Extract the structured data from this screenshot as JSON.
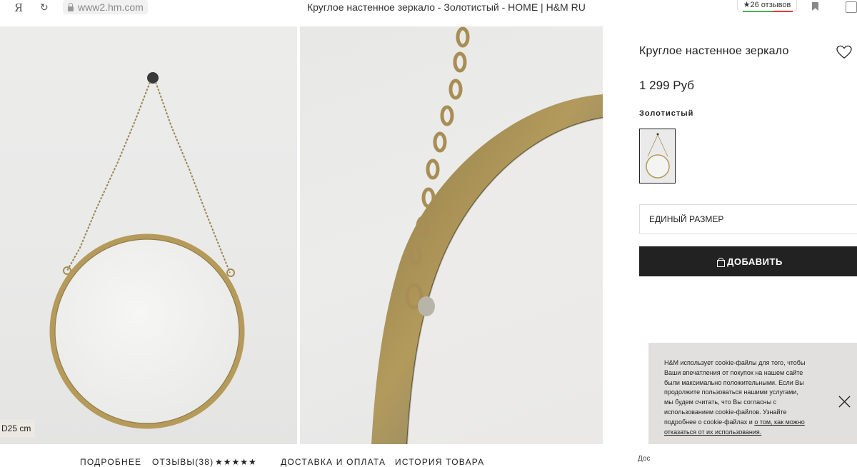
{
  "browser": {
    "ya_glyph": "Я",
    "reload_glyph": "↻",
    "url": "www2.hm.com",
    "tab_title": "Круглое настенное зеркало - Золотистый - HOME | H&M RU",
    "reviews_badge": "★26 отзывов"
  },
  "product": {
    "title": "Круглое настенное зеркало",
    "price": "1 299 Руб",
    "color_label": "Золотистый",
    "size_value": "ЕДИНЫЙ РАЗМЕР",
    "add_button": "ДОБАВИТЬ",
    "size_tag": "D25 cm"
  },
  "cookie": {
    "text": "H&M использует cookie-файлы для того, чтобы Ваши впечатления от покупок на нашем сайте были максимально положительными. Если Вы продолжите пользоваться нашими услугами, мы будем считать, что Вы согласны с использованием cookie-файлов. Узнайте подробнее о cookie-файлах и ",
    "link": "о том, как можно отказаться от их использования."
  },
  "bottom_nav": {
    "details": "ПОДРОБНЕЕ",
    "reviews": "ОТЗЫВЫ(38)",
    "stars": "★★★★★",
    "delivery": "ДОСТАВКА И ОПЛАТА",
    "history": "ИСТОРИЯ ТОВАРА",
    "cut_text": "Дос"
  },
  "colors": {
    "button_bg": "#222222",
    "cookie_bg": "#e2e0de",
    "gold": "#b59a5a"
  },
  "icons": [
    "lock-icon",
    "heart-icon",
    "bag-icon",
    "close-icon",
    "bookmark-icon"
  ]
}
